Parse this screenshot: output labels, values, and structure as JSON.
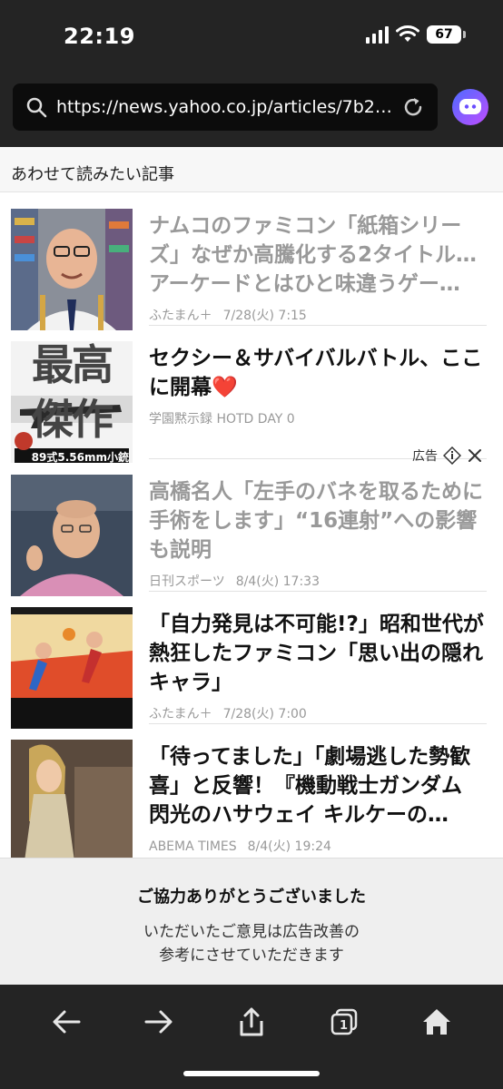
{
  "status": {
    "time": "22:19",
    "battery": "67"
  },
  "browser": {
    "url": "https://news.yahoo.co.jp/articles/7b270..."
  },
  "section": {
    "title": "あわせて読みたい記事"
  },
  "articles": [
    {
      "title": "ナムコのファミコン「紙箱シリーズ」なぜか高騰化する2タイトル…アーケードとはひと味違うゲー…",
      "source": "ふたまん＋",
      "date": "7/28(火) 7:15",
      "read": true
    },
    {
      "title": "セクシー＆サバイバルバトル、ここに開幕❤️",
      "source": "学園黙示録 HOTD DAY 0",
      "date": "",
      "read": false,
      "ad": true,
      "thumb_text_top": "最高",
      "thumb_text_bottom": "傑作",
      "thumb_caption": "89式5.56mm小銃"
    },
    {
      "title": "高橋名人「左手のバネを取るために手術をします」“16連射”への影響も説明",
      "source": "日刊スポーツ",
      "date": "8/4(火) 17:33",
      "read": true
    },
    {
      "title": "「自力発見は不可能!?」昭和世代が熱狂したファミコン「思い出の隠れキャラ」",
      "source": "ふたまん＋",
      "date": "7/28(火) 7:00",
      "read": false
    },
    {
      "title": "「待ってました」「劇場逃した勢歓喜」と反響！『機動戦士ガンダム 閃光のハサウェイ キルケーの…",
      "source": "ABEMA TIMES",
      "date": "8/4(火) 19:24",
      "read": false
    }
  ],
  "ad_label": "広告",
  "feedback": {
    "title": "ご協力ありがとうございました",
    "line1": "いただいたご意見は広告改善の",
    "line2": "参考にさせていただきます"
  },
  "toolbar": {
    "tab_count": "1"
  },
  "icons": [
    "search-icon",
    "reload-icon",
    "assistant-icon",
    "info-icon",
    "close-icon",
    "back-icon",
    "forward-icon",
    "share-icon",
    "tabs-icon",
    "home-icon"
  ]
}
